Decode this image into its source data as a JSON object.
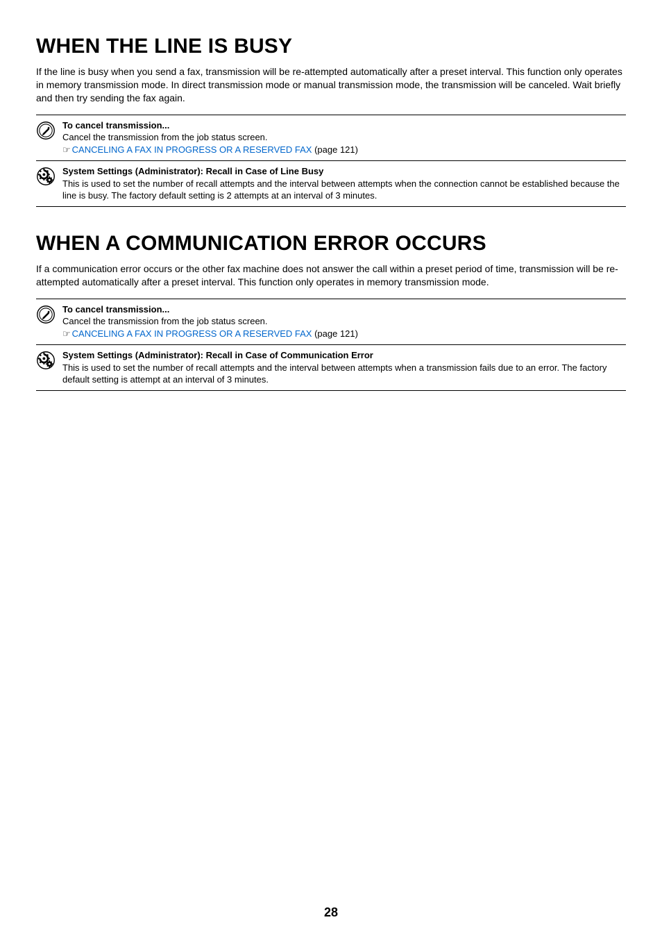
{
  "page_number": "28",
  "sections": [
    {
      "heading": "WHEN THE LINE IS BUSY",
      "paragraph": "If the line is busy when you send a fax, transmission will be re-attempted automatically after a preset interval. This function only operates in memory transmission mode. In direct transmission mode or manual transmission mode, the transmission will be canceled. Wait briefly and then try sending the fax again.",
      "notes": [
        {
          "icon": "pencil",
          "title": "To cancel transmission...",
          "body": "Cancel the transmission from the job status screen.",
          "link_text": "CANCELING A FAX IN PROGRESS OR A RESERVED FAX",
          "link_suffix": " (page 121)"
        },
        {
          "icon": "gear",
          "title": "System Settings (Administrator): Recall in Case of Line Busy",
          "body": "This is used to set the number of recall attempts and the interval between attempts when the connection cannot be established because the line is busy. The factory default setting is 2 attempts at an interval of 3 minutes."
        }
      ]
    },
    {
      "heading": "WHEN A COMMUNICATION ERROR OCCURS",
      "paragraph": "If a communication error occurs or the other fax machine does not answer the call within a preset period of time, transmission will be re-attempted automatically after a preset interval. This function only operates in memory transmission mode.",
      "notes": [
        {
          "icon": "pencil",
          "title": "To cancel transmission...",
          "body": "Cancel the transmission from the job status screen.",
          "link_text": "CANCELING A FAX IN PROGRESS OR A RESERVED FAX",
          "link_suffix": " (page 121)"
        },
        {
          "icon": "gear",
          "title": "System Settings (Administrator): Recall in Case of Communication Error",
          "body": "This is used to set the number of recall attempts and the interval between attempts when a transmission fails due to an error. The factory default setting is attempt at an interval of 3 minutes."
        }
      ]
    }
  ]
}
